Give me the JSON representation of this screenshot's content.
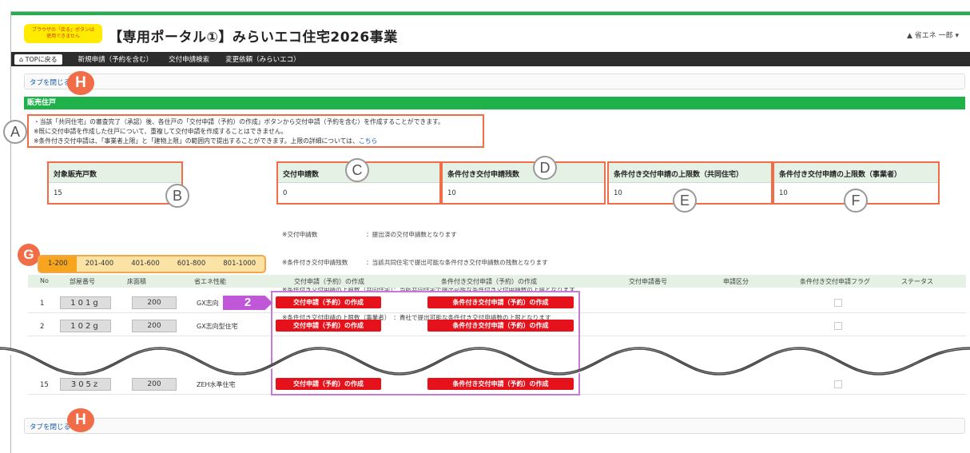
{
  "header": {
    "warning_line1": "ブラウザの「戻る」ボタンは",
    "warning_line2": "使用できません",
    "title": "【専用ポータル①】みらいエコ住宅2026事業",
    "user": "▲ 省エネ 一郎 ▾"
  },
  "nav": {
    "top": "TOPに戻る",
    "items": [
      "新規申請（予約を含む）",
      "交付申請検索",
      "変更依頼（みらいエコ）"
    ]
  },
  "close_tab": "タブを閉じる",
  "section_title": "販売住戸",
  "notes": {
    "line1": "・当該「共同住宅」の審査完了（承認）後、各住戸の「交付申請（予約）の作成」ボタンから交付申請（予約を含む）を作成することができます。",
    "line2": "※既に交付申請を作成した住戸について、重複して交付申請を作成することはできません。",
    "line3": "※条件付き交付申請は、「事業者上限」と「建物上限」の範囲内で提出することができます。上限の詳細については、",
    "link": "こちら"
  },
  "stats": {
    "target": {
      "label": "対象販売戸数",
      "value": "15"
    },
    "applied": {
      "label": "交付申請数",
      "value": "0"
    },
    "remaining": {
      "label": "条件付き交付申請残数",
      "value": "10"
    },
    "limit_building": {
      "label": "条件付き交付申請の上限数（共同住宅）",
      "value": "10"
    },
    "limit_business": {
      "label": "条件付き交付申請の上限数（事業者）",
      "value": "10"
    }
  },
  "info_lines": [
    "※交付申請数　　　　　　　　：提出済の交付申請数となります",
    "※条件付き交付申請残数　　　：当該共同住宅で提出可能な条件付き交付申請数の残数となります",
    "※条件付き交付申請の上限数（共同住宅）：当該共同住宅で提出可能な条件付き交付申請数の上限となります",
    "※条件付き交付申請の上限数（事業者）　：貴社で提出可能な条件付き交付申請数の上限となります"
  ],
  "page_tabs": [
    "1-200",
    "201-400",
    "401-600",
    "601-800",
    "801-1000"
  ],
  "table": {
    "headers": [
      "No",
      "部屋番号",
      "床面積",
      "省エネ性能",
      "交付申請（予約）の作成",
      "条件付き交付申請（予約）の作成",
      "交付申請番号",
      "申請区分",
      "条件付き交付申請フラグ",
      "ステータス"
    ],
    "rows": [
      {
        "no": "1",
        "room": "101g",
        "area": "200",
        "perf": "GX志向"
      },
      {
        "no": "2",
        "room": "102g",
        "area": "200",
        "perf": "GX志向型住宅"
      },
      {
        "no": "15",
        "room": "305z",
        "area": "200",
        "perf": "ZEH水準住宅"
      }
    ],
    "btn1": "交付申請（予約）の作成",
    "btn2": "条件付き交付申請（予約）の作成"
  },
  "annotations": {
    "A": "A",
    "B": "B",
    "C": "C",
    "D": "D",
    "E": "E",
    "F": "F",
    "G": "G",
    "H": "H",
    "step": "2"
  },
  "colors": {
    "accent_green": "#1fb24a",
    "annotation_orange": "#f06d47",
    "button_red": "#e6121b",
    "annotation_purple": "#c057d9"
  }
}
